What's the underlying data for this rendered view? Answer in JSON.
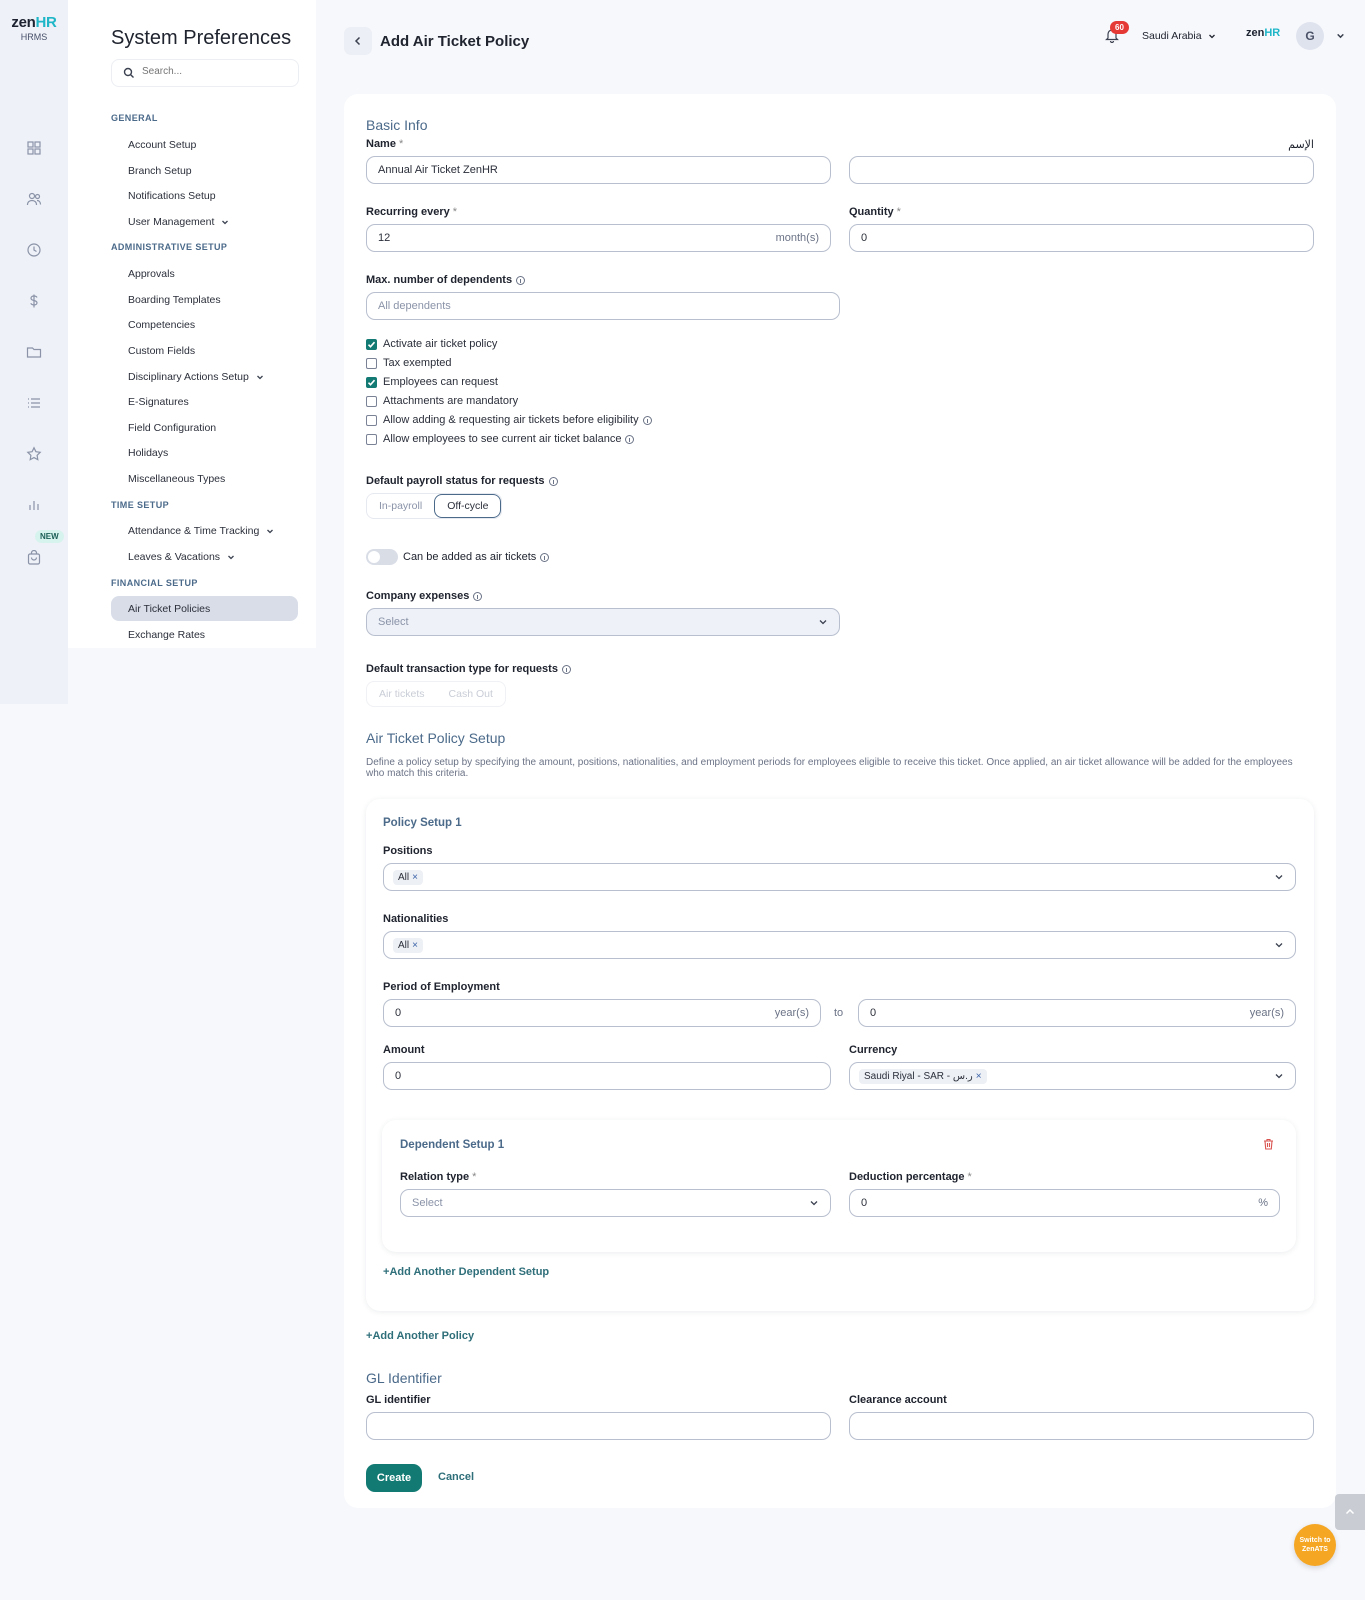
{
  "logo": {
    "brand_a": "zen",
    "brand_b": "HR",
    "sub": "HRMS"
  },
  "rail": {
    "new_badge": "NEW"
  },
  "settings": {
    "title": "System Preferences",
    "search_placeholder": "Search...",
    "sections": {
      "general": "GENERAL",
      "admin": "ADMINISTRATIVE SETUP",
      "time": "TIME SETUP",
      "financial": "FINANCIAL SETUP"
    },
    "items": {
      "account_setup": "Account Setup",
      "branch_setup": "Branch Setup",
      "notifications_setup": "Notifications Setup",
      "user_management": "User Management",
      "approvals": "Approvals",
      "boarding_templates": "Boarding Templates",
      "competencies": "Competencies",
      "custom_fields": "Custom Fields",
      "disciplinary_actions": "Disciplinary Actions Setup",
      "e_signatures": "E-Signatures",
      "field_configuration": "Field Configuration",
      "holidays": "Holidays",
      "misc_types": "Miscellaneous Types",
      "attendance": "Attendance & Time Tracking",
      "leaves": "Leaves & Vacations",
      "air_ticket_policies": "Air Ticket Policies",
      "exchange_rates": "Exchange Rates"
    }
  },
  "header": {
    "title": "Add Air Ticket Policy",
    "notifications_count": "60",
    "country": "Saudi Arabia",
    "zen_a": "zen",
    "zen_b": "HR",
    "avatar_initial": "G"
  },
  "basic_info": {
    "title": "Basic Info",
    "name_label": "Name",
    "name_value": "Annual Air Ticket ZenHR",
    "name_ar_label": "الإسم",
    "name_ar_value": "",
    "recurring_label": "Recurring every",
    "recurring_value": "12",
    "recurring_suffix": "month(s)",
    "quantity_label": "Quantity",
    "quantity_value": "0",
    "max_dependents_label": "Max. number of dependents",
    "max_dependents_placeholder": "All dependents",
    "checkboxes": [
      {
        "label": "Activate air ticket policy",
        "checked": true
      },
      {
        "label": "Tax exempted",
        "checked": false
      },
      {
        "label": "Employees can request",
        "checked": true
      },
      {
        "label": "Attachments are mandatory",
        "checked": false
      },
      {
        "label": "Allow adding & requesting air tickets before eligibility",
        "checked": false
      },
      {
        "label": "Allow employees to see current air ticket balance",
        "checked": false
      }
    ],
    "payroll_status_label": "Default payroll status for requests",
    "payroll_options": [
      "In-payroll",
      "Off-cycle"
    ],
    "payroll_selected": "Off-cycle",
    "air_tickets_toggle_label": "Can be added as air tickets",
    "company_expenses_label": "Company expenses",
    "company_expenses_placeholder": "Select",
    "transaction_type_label": "Default transaction type for requests",
    "transaction_options": [
      "Air tickets",
      "Cash Out"
    ]
  },
  "policy_setup": {
    "title": "Air Ticket Policy Setup",
    "description": "Define a policy setup by specifying the amount, positions, nationalities, and employment periods for employees eligible to receive this ticket. Once applied, an air ticket allowance will be added for the employees who match this criteria.",
    "box_title": "Policy Setup 1",
    "positions_label": "Positions",
    "positions_chip": "All",
    "nationalities_label": "Nationalities",
    "nationalities_chip": "All",
    "period_label": "Period of Employment",
    "period_from": "0",
    "period_to": "0",
    "period_suffix": "year(s)",
    "to_text": "to",
    "amount_label": "Amount",
    "amount_value": "0",
    "currency_label": "Currency",
    "currency_chip": "Saudi Riyal - SAR - ر.س",
    "dependent": {
      "title": "Dependent Setup 1",
      "relation_label": "Relation type",
      "relation_placeholder": "Select",
      "deduction_label": "Deduction percentage",
      "deduction_value": "0",
      "deduction_suffix": "%"
    },
    "add_dependent": "Add Another Dependent Setup",
    "add_policy": "Add Another Policy"
  },
  "gl": {
    "title": "GL Identifier",
    "identifier_label": "GL identifier",
    "identifier_value": "",
    "clearance_label": "Clearance account",
    "clearance_value": ""
  },
  "actions": {
    "create": "Create",
    "cancel": "Cancel"
  },
  "floating": {
    "switch_line1": "Switch to",
    "switch_line2": "ZenATS"
  },
  "colors": {
    "primary": "#137a73",
    "accent": "#1fb6c8",
    "section": "#4b6a8a",
    "danger": "#e53935",
    "ats": "#f5a623"
  }
}
